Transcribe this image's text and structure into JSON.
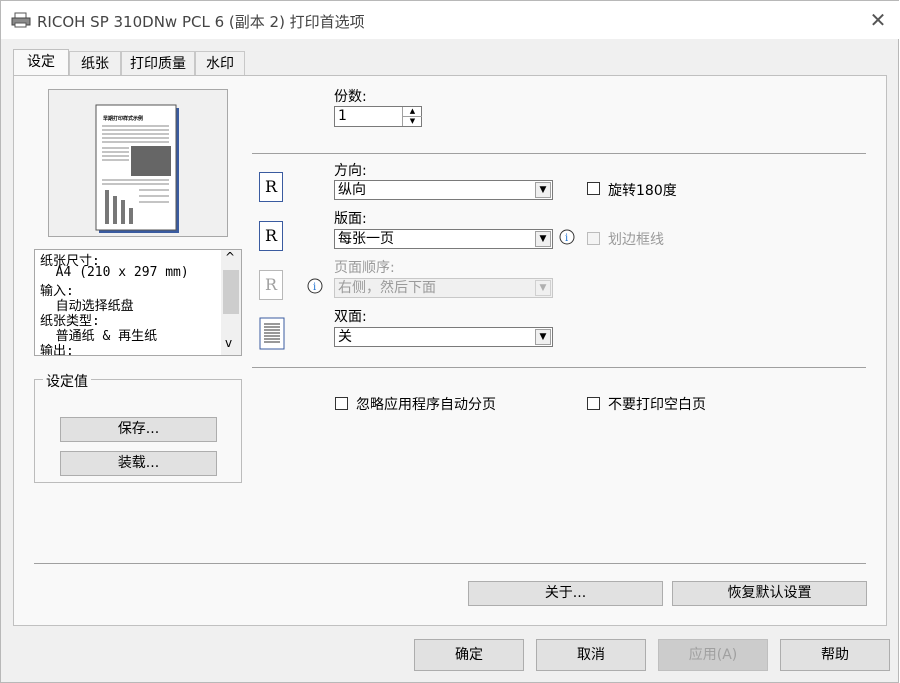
{
  "window": {
    "title": "RICOH SP 310DNw PCL 6 (副本 2) 打印首选项",
    "close_glyph": "✕"
  },
  "tabs": [
    {
      "label": "设定",
      "active": true
    },
    {
      "label": "纸张",
      "active": false
    },
    {
      "label": "打印质量",
      "active": false
    },
    {
      "label": "水印",
      "active": false
    }
  ],
  "preview": {
    "page_heading": "早期打印样式示例",
    "icon": "page-preview-icon"
  },
  "info_list": {
    "lines": [
      "纸张尺寸:",
      "  A4 (210 x 297 mm)",
      "输入:",
      "  自动选择纸盘",
      "纸张类型:",
      "  普通纸 & 再生纸",
      "输出:"
    ],
    "scroll_up": "^",
    "scroll_down": "v"
  },
  "settings_group": {
    "title": "设定值",
    "save_label": "保存...",
    "load_label": "装载..."
  },
  "copies": {
    "label": "份数:",
    "value": "1"
  },
  "orientation": {
    "label": "方向:",
    "value": "纵向",
    "rotate_label": "旋转180度",
    "rotate_checked": false
  },
  "layout": {
    "label": "版面:",
    "value": "每张一页",
    "border_label": "划边框线",
    "border_checked": false
  },
  "page_order": {
    "label": "页面顺序:",
    "value": "右侧，然后下面"
  },
  "duplex": {
    "label": "双面:",
    "value": "关"
  },
  "options": {
    "ignore_breaks_label": "忽略应用程序自动分页",
    "skip_blank_label": "不要打印空白页"
  },
  "icons": {
    "orientation_glyph": "R",
    "layout_glyph": "R",
    "order_glyph": "R"
  },
  "panel_buttons": {
    "about_label": "关于...",
    "restore_label": "恢复默认设置"
  },
  "dialog_buttons": {
    "ok_label": "确定",
    "cancel_label": "取消",
    "apply_label": "应用(A)",
    "help_label": "帮助"
  }
}
